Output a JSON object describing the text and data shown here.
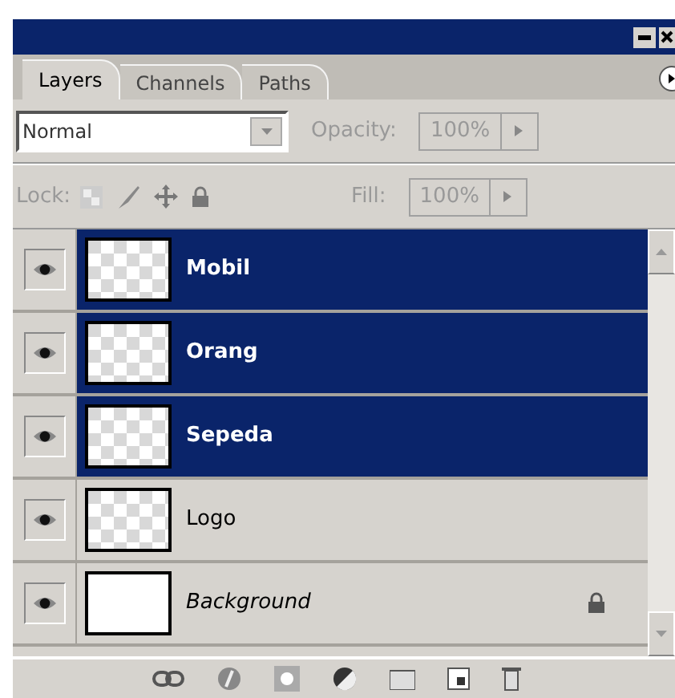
{
  "tabs": [
    {
      "label": "Layers",
      "selected": true
    },
    {
      "label": "Channels",
      "selected": false
    },
    {
      "label": "Paths",
      "selected": false
    }
  ],
  "blend_mode": {
    "value": "Normal"
  },
  "opacity": {
    "label": "Opacity:",
    "value": "100%"
  },
  "lock": {
    "label": "Lock:"
  },
  "fill": {
    "label": "Fill:",
    "value": "100%"
  },
  "layers": [
    {
      "name": "Mobil",
      "selected": true,
      "visible": true,
      "kind": "transparent",
      "locked": false
    },
    {
      "name": "Orang",
      "selected": true,
      "visible": true,
      "kind": "transparent",
      "locked": false
    },
    {
      "name": "Sepeda",
      "selected": true,
      "visible": true,
      "kind": "transparent",
      "locked": false
    },
    {
      "name": "Logo",
      "selected": false,
      "visible": true,
      "kind": "transparent",
      "locked": false
    },
    {
      "name": "Background",
      "selected": false,
      "visible": true,
      "kind": "background",
      "locked": true
    }
  ]
}
